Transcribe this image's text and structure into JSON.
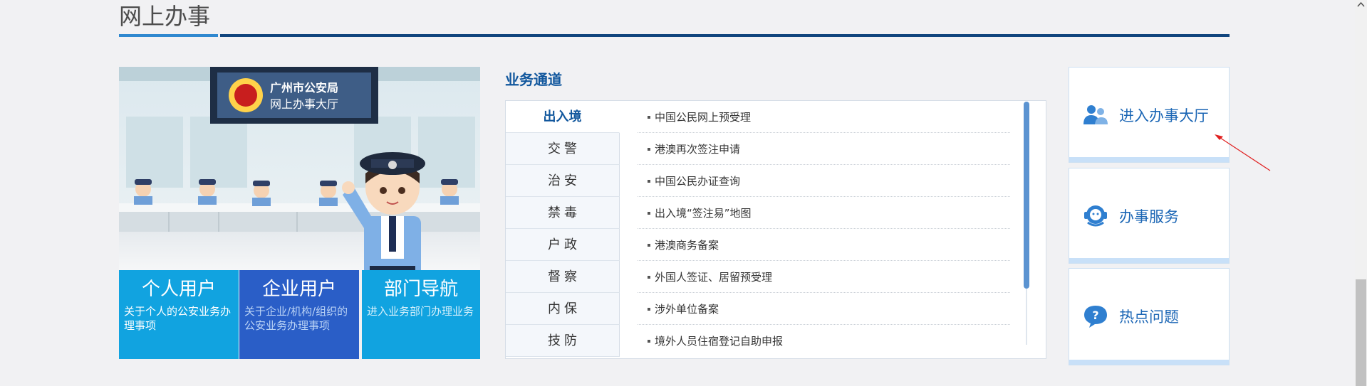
{
  "section": {
    "title": "网上办事"
  },
  "illustration": {
    "sign_line1": "广州市公安局",
    "sign_line2": "网上办事大厅"
  },
  "tiles": [
    {
      "title": "个人用户",
      "desc": "关于个人的公安业务办理事项"
    },
    {
      "title": "企业用户",
      "desc": "关于企业/机构/组织的公安业务办理事项"
    },
    {
      "title": "部门导航",
      "desc": "进入业务部门办理业务"
    }
  ],
  "channel": {
    "heading": "业务通道",
    "categories": [
      {
        "a": "出入境",
        "b": "",
        "c": ""
      },
      {
        "a": "交",
        "b": "警",
        "c": ""
      },
      {
        "a": "治",
        "b": "安",
        "c": ""
      },
      {
        "a": "禁",
        "b": "毒",
        "c": ""
      },
      {
        "a": "户",
        "b": "政",
        "c": ""
      },
      {
        "a": "督",
        "b": "察",
        "c": ""
      },
      {
        "a": "内",
        "b": "保",
        "c": ""
      },
      {
        "a": "技",
        "b": "防",
        "c": ""
      }
    ],
    "active_category": "出入境",
    "services": [
      "中国公民网上预受理",
      "港澳再次签注申请",
      "中国公民办证查询",
      "出入境“签注易”地图",
      "港澳商务备案",
      "外国人签证、居留预受理",
      "涉外单位备案",
      "境外人员住宿登记自助申报"
    ]
  },
  "cards": [
    {
      "label": "进入办事大厅",
      "icon": "users-icon"
    },
    {
      "label": "办事服务",
      "icon": "service-agent-icon"
    },
    {
      "label": "热点问题",
      "icon": "question-bubble-icon"
    }
  ],
  "colors": {
    "brand_dark": "#11457d",
    "brand_accent": "#2f88cf",
    "tile_cyan": "#11a3e0",
    "tile_blue": "#2a5ec7",
    "link_blue": "#1b66b5",
    "annotation_red": "#e02020"
  }
}
